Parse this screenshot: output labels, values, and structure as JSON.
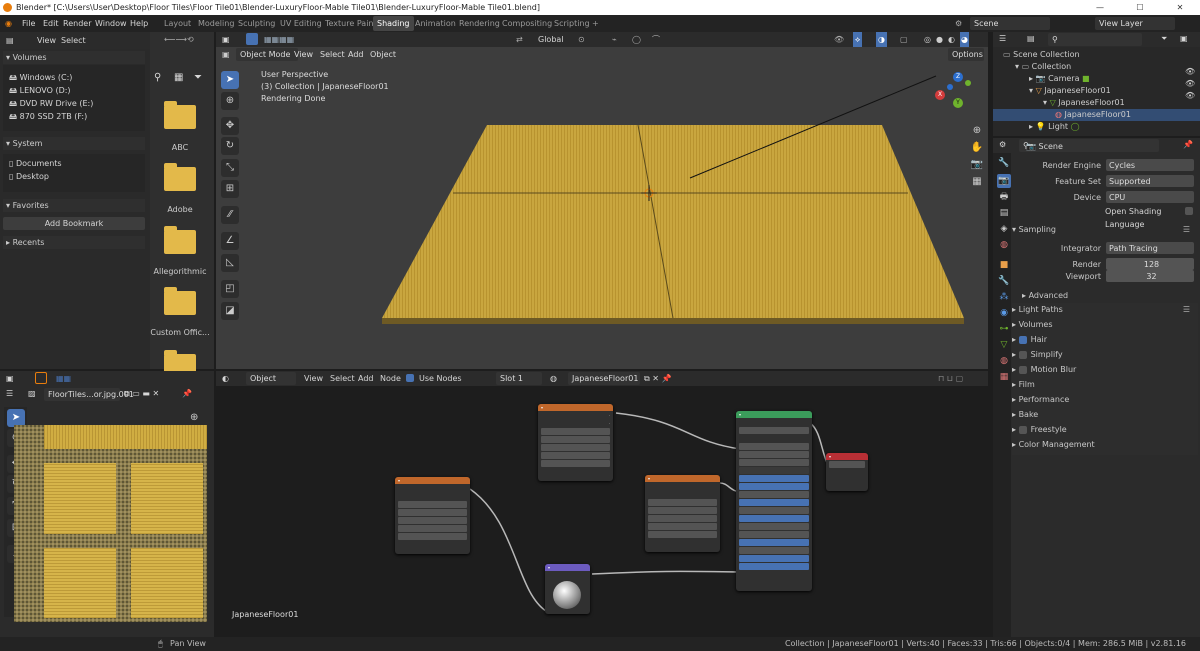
{
  "titlebar": {
    "title": "Blender* [C:\\Users\\User\\Desktop\\Floor Tiles\\Floor Tile01\\Blender-LuxuryFloor-Mable Tile01\\Blender-LuxuryFloor-Mable Tile01.blend]",
    "min": "—",
    "max": "☐",
    "close": "✕"
  },
  "menu": {
    "file": "File",
    "edit": "Edit",
    "render": "Render",
    "window": "Window",
    "help": "Help"
  },
  "workspaces": [
    "Layout",
    "Modeling",
    "Sculpting",
    "UV Editing",
    "Texture Paint",
    "Shading",
    "Animation",
    "Rendering",
    "Compositing",
    "Scripting",
    "+"
  ],
  "scene": {
    "scene_name": "Scene",
    "view_layer": "View Layer"
  },
  "filebrowser": {
    "view": "View",
    "select": "Select",
    "volumes_title": "Volumes",
    "volumes": [
      "Windows (C:)",
      "LENOVO (D:)",
      "DVD RW Drive (E:)",
      "870 SSD 2TB (F:)"
    ],
    "system_title": "System",
    "system": [
      "Documents",
      "Desktop"
    ],
    "favorites_title": "Favorites",
    "add_bookmark": "Add Bookmark",
    "recents_title": "Recents",
    "folders": [
      "ABC",
      "Adobe",
      "Allegorithmic",
      "Custom Offic..."
    ]
  },
  "viewport": {
    "mode": "Object Mode",
    "view": "View",
    "select": "Select",
    "add": "Add",
    "object": "Object",
    "global": "Global",
    "options": "Options",
    "info1": "User Perspective",
    "info2": "(3) Collection | JapaneseFloor01",
    "info3": "Rendering Done"
  },
  "outliner": {
    "search_placeholder": "",
    "items": [
      "Scene Collection",
      "Collection",
      "Camera",
      "JapaneseFloor01",
      "JapaneseFloor01",
      "JapaneseFloor01",
      "Light"
    ]
  },
  "properties": {
    "scene_label": "Scene",
    "render_engine_label": "Render Engine",
    "render_engine": "Cycles",
    "feature_set_label": "Feature Set",
    "feature_set": "Supported",
    "device_label": "Device",
    "device": "CPU",
    "osl_label": "Open Shading Language",
    "sampling": "Sampling",
    "integrator_label": "Integrator",
    "integrator": "Path Tracing",
    "render_label": "Render",
    "render_value": "128",
    "viewport_label": "Viewport",
    "viewport_value": "32",
    "advanced": "Advanced",
    "sections": [
      "Light Paths",
      "Volumes",
      "Hair",
      "Simplify",
      "Motion Blur",
      "Film",
      "Performance",
      "Bake",
      "Freestyle",
      "Color Management"
    ]
  },
  "image_editor": {
    "image_name": "FloorTiles...or.jpg.001"
  },
  "node_editor": {
    "object": "Object",
    "view": "View",
    "select": "Select",
    "add": "Add",
    "node": "Node",
    "use_nodes": "Use Nodes",
    "slot": "Slot 1",
    "material": "JapaneseFloor01",
    "footer_label": "JapaneseFloor01"
  },
  "statusbar": {
    "pan_view": "Pan View",
    "stats": "Collection | JapaneseFloor01 | Verts:40 | Faces:33 | Tris:66 | Objects:0/4 | Mem: 286.5 MiB | v2.81.16"
  },
  "colors": {
    "accent": "#4772b3",
    "floor": "#c9a63f",
    "node_image": "#c0672b",
    "node_bsdf": "#3b9c5b",
    "node_output": "#b82f35",
    "node_normal": "#6c5bbf"
  }
}
